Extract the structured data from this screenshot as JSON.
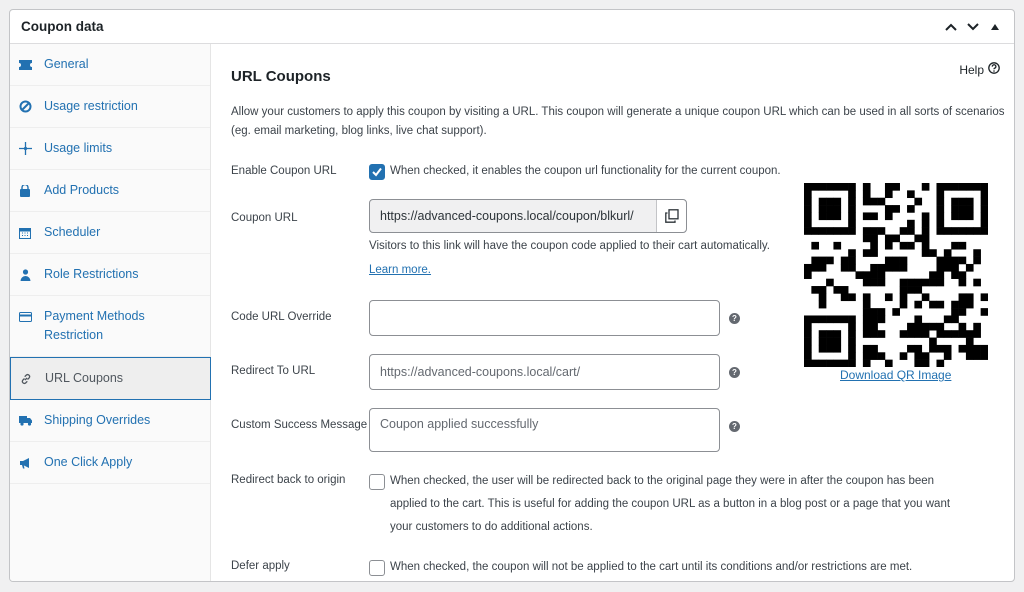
{
  "panel": {
    "title": "Coupon data"
  },
  "tabs": [
    {
      "label": "General",
      "icon": "ticket-icon"
    },
    {
      "label": "Usage restriction",
      "icon": "block-icon"
    },
    {
      "label": "Usage limits",
      "icon": "crosshair-icon"
    },
    {
      "label": "Add Products",
      "icon": "cart-icon"
    },
    {
      "label": "Scheduler",
      "icon": "calendar-icon"
    },
    {
      "label": "Role Restrictions",
      "icon": "user-icon"
    },
    {
      "label": "Payment Methods Restriction",
      "icon": "card-icon"
    },
    {
      "label": "URL Coupons",
      "icon": "link-icon",
      "active": true
    },
    {
      "label": "Shipping Overrides",
      "icon": "truck-icon"
    },
    {
      "label": "One Click Apply",
      "icon": "megaphone-icon"
    }
  ],
  "content": {
    "title": "URL Coupons",
    "help_label": "Help",
    "description": "Allow your customers to apply this coupon by visiting a URL. This coupon will generate a unique coupon URL which can be used in all sorts of scenarios (eg. email marketing, blog links, live chat support).",
    "enable": {
      "label": "Enable Coupon URL",
      "text": "When checked, it enables the coupon url functionality for the current coupon.",
      "checked": true
    },
    "coupon_url": {
      "label": "Coupon URL",
      "value": "https://advanced-coupons.local/coupon/blkurl/",
      "help": "Visitors to this link will have the coupon code applied to their cart automatically.",
      "learn_more": "Learn more."
    },
    "code_override": {
      "label": "Code URL Override",
      "value": ""
    },
    "redirect_url": {
      "label": "Redirect To URL",
      "placeholder": "https://advanced-coupons.local/cart/"
    },
    "success_msg": {
      "label": "Custom Success Message",
      "placeholder": "Coupon applied successfully"
    },
    "redirect_origin": {
      "label": "Redirect back to origin",
      "line1": "When checked, the user will be redirected back to the original page they were in after the coupon has been",
      "line2": "applied to the cart. This is useful for adding the coupon URL as a button in a blog post or a page that you want",
      "line3": "your customers to do additional actions.",
      "checked": false
    },
    "defer": {
      "label": "Defer apply",
      "text": "When checked, the coupon will not be applied to the cart until its conditions and/or restrictions are met.",
      "checked": false
    },
    "qr": {
      "download_label": "Download QR Image"
    }
  },
  "colors": {
    "accent": "#2271b1",
    "text": "#3c434a",
    "border": "#8c8f94"
  }
}
